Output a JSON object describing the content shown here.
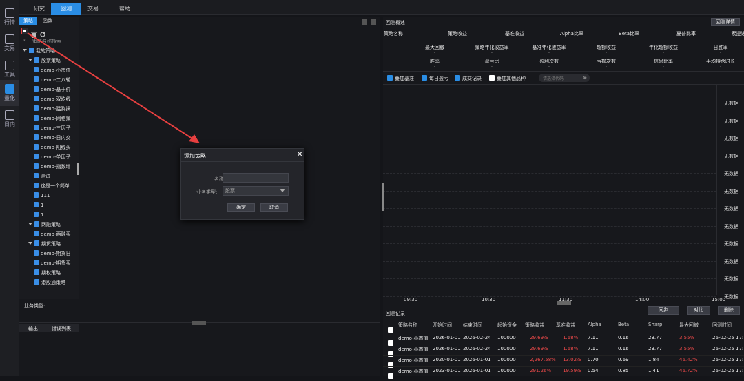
{
  "rail": [
    {
      "label": "行情",
      "icon": "chart-icon"
    },
    {
      "label": "交易",
      "icon": "exchange-icon"
    },
    {
      "label": "工具",
      "icon": "toolbox-icon"
    },
    {
      "label": "量化",
      "icon": "quant-icon"
    },
    {
      "label": "日内",
      "icon": "intraday-icon"
    }
  ],
  "top_tabs": [
    "研究",
    "回测",
    "交易",
    "帮助"
  ],
  "left": {
    "subtabs": [
      "策略",
      "函数"
    ],
    "search_placeholder": "策略名称搜索",
    "tree": [
      {
        "label": "我的策略",
        "level": 0,
        "type": "folder",
        "expanded": true
      },
      {
        "label": "股票策略",
        "level": 1,
        "type": "folder",
        "expanded": true
      },
      {
        "label": "demo-小市值",
        "level": 2,
        "type": "file"
      },
      {
        "label": "demo-二八轮",
        "level": 2,
        "type": "file"
      },
      {
        "label": "demo-基于价",
        "level": 2,
        "type": "file"
      },
      {
        "label": "demo-双均线",
        "level": 2,
        "type": "file"
      },
      {
        "label": "demo-猛狗擒",
        "level": 2,
        "type": "file"
      },
      {
        "label": "demo-网格策",
        "level": 2,
        "type": "file"
      },
      {
        "label": "demo-三因子",
        "level": 2,
        "type": "file"
      },
      {
        "label": "demo-日内交",
        "level": 2,
        "type": "file"
      },
      {
        "label": "demo-阳线买",
        "level": 2,
        "type": "file"
      },
      {
        "label": "demo-单因子",
        "level": 2,
        "type": "file"
      },
      {
        "label": "demo-指数增",
        "level": 2,
        "type": "file"
      },
      {
        "label": "测试",
        "level": 2,
        "type": "file"
      },
      {
        "label": "这是一个简单",
        "level": 2,
        "type": "file"
      },
      {
        "label": "111",
        "level": 2,
        "type": "file"
      },
      {
        "label": "1",
        "level": 2,
        "type": "file"
      },
      {
        "label": "1",
        "level": 2,
        "type": "file"
      },
      {
        "label": "两融策略",
        "level": 1,
        "type": "folder",
        "expanded": true
      },
      {
        "label": "demo-两融买",
        "level": 2,
        "type": "file"
      },
      {
        "label": "期货策略",
        "level": 1,
        "type": "folder",
        "expanded": true
      },
      {
        "label": "demo-期货日",
        "level": 2,
        "type": "file"
      },
      {
        "label": "demo-期货买",
        "level": 2,
        "type": "file"
      },
      {
        "label": "期权策略",
        "level": 1,
        "type": "folder",
        "expanded": false
      },
      {
        "label": "港股通策略",
        "level": 1,
        "type": "folder",
        "expanded": false
      }
    ],
    "business_type_label": "业务类型:",
    "bottom_tabs": [
      "输出",
      "错误列表"
    ]
  },
  "dialog": {
    "title": "添加策略",
    "name_label": "名称:",
    "type_label": "业务类型:",
    "type_value": "股票",
    "ok": "确定",
    "cancel": "取消"
  },
  "right": {
    "title": "回测概述",
    "detail_button": "回测详情",
    "metrics_row1": [
      "策略名称",
      "策略收益",
      "基准收益",
      "Alpha比率",
      "Beta比率",
      "夏普比率",
      "索提诺比率"
    ],
    "metrics_row2": [
      "最大回撤",
      "策略年化收益率",
      "基准年化收益率",
      "超额收益",
      "年化超额收益",
      "日胜率"
    ],
    "metrics_row3": [
      "胜率",
      "盈亏比",
      "盈利次数",
      "亏损次数",
      "信息比率",
      "平均持仓时长"
    ],
    "dash": "-",
    "checks": [
      {
        "label": "叠加基准",
        "on": true
      },
      {
        "label": "每日盈亏",
        "on": true
      },
      {
        "label": "成交记录",
        "on": true
      },
      {
        "label": "叠加其他品种",
        "on": false
      }
    ],
    "chart_search_placeholder": "请选择代码",
    "no_data": "无数据",
    "time_labels": [
      "09:30",
      "10:30",
      "11:30",
      "14:00",
      "15:00"
    ],
    "records_title": "回测记录",
    "record_buttons": [
      "同步",
      "对比",
      "删除"
    ],
    "columns": [
      "策略名称",
      "开始时间",
      "结束时间",
      "起始资金",
      "策略收益",
      "基准收益",
      "Alpha",
      "Beta",
      "Sharp",
      "最大回撤",
      "回测时间"
    ],
    "rows": [
      [
        "demo-小市值",
        "2026-01-01",
        "2026-02-24",
        "100000",
        "29.69%",
        "1.68%",
        "7.11",
        "0.16",
        "23.77",
        "3.55%",
        "26-02-25 17:"
      ],
      [
        "demo-小市值",
        "2026-01-01",
        "2026-02-24",
        "100000",
        "29.69%",
        "1.68%",
        "7.11",
        "0.16",
        "23.77",
        "3.55%",
        "26-02-25 17:"
      ],
      [
        "demo-小市值",
        "2020-01-01",
        "2026-01-01",
        "100000",
        "2,267.58%",
        "13.02%",
        "0.70",
        "0.69",
        "1.84",
        "46.42%",
        "26-02-25 17:"
      ],
      [
        "demo-小市值",
        "2023-01-01",
        "2026-01-01",
        "100000",
        "291.26%",
        "19.59%",
        "0.54",
        "0.85",
        "1.41",
        "46.72%",
        "26-02-25 17:"
      ]
    ]
  },
  "colors": {
    "accent": "#2a8de4",
    "annotation": "#e84040",
    "positive": "#ef4a4a"
  }
}
